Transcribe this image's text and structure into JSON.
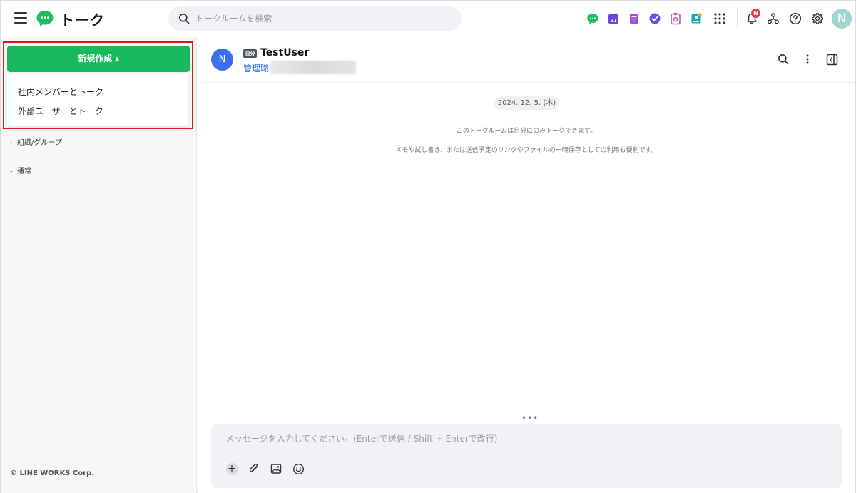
{
  "header": {
    "app_title": "トーク",
    "search_placeholder": "トークルームを検索",
    "notification_badge": "N",
    "user_initial": "N",
    "app_icons": [
      "talk-icon",
      "calendar-icon",
      "note-icon",
      "task-icon",
      "form-icon",
      "contacts-icon"
    ],
    "calendar_day": "31"
  },
  "sidebar": {
    "new_button_label": "新規作成",
    "dropdown_items": [
      "社内メンバーとトーク",
      "外部ユーザーとトーク"
    ],
    "tree_items": [
      "組織/グループ",
      "通常"
    ],
    "copyright": "© LINE WORKS Corp."
  },
  "room": {
    "avatar_initial": "N",
    "self_tag": "自分",
    "name": "TestUser",
    "role": "管理職",
    "date": "2024. 12. 5. (木)",
    "system_messages": [
      "このトークルームは自分にのみトークできます。",
      "メモや試し書き、または送信予定のリンクやファイルの一時保存としての利用も便利です。"
    ]
  },
  "composer": {
    "placeholder": "メッセージを入力してください。(Enterで送信 / Shift + Enterで改行)"
  },
  "colors": {
    "accent_green": "#18b85c",
    "highlight_red": "#e3141b",
    "avatar_blue": "#3c6ff0",
    "role_blue": "#2f6fde",
    "badge_red": "#e8384f"
  }
}
